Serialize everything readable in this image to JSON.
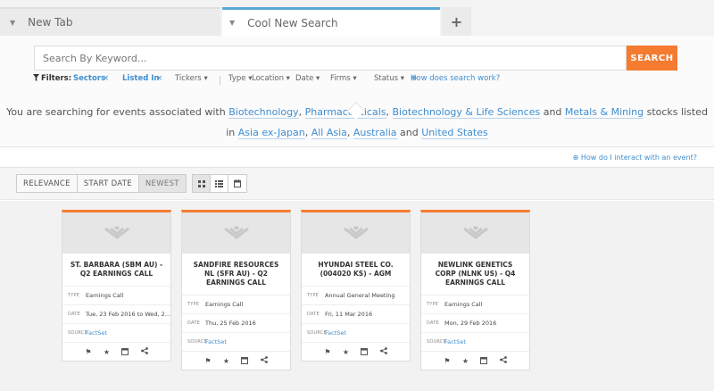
{
  "tabs": [
    {
      "label": "New Tab"
    },
    {
      "label": "Cool New Search"
    }
  ],
  "tab_add_label": "+",
  "search": {
    "placeholder": "Search By Keyword...",
    "button_label": "SEARCH"
  },
  "filters": {
    "label": "Filters:",
    "selected": [
      {
        "label": "Sectors",
        "remove": "×"
      },
      {
        "label": "Listed In",
        "remove": "×"
      }
    ],
    "dropdowns": [
      "Tickers",
      "Type",
      "Location",
      "Date",
      "Firms",
      "Status"
    ],
    "help_link": "How does search work?"
  },
  "description": {
    "prefix": "You are searching for events associated with",
    "sectors": [
      "Biotechnology",
      "Pharmaceuticals",
      "Biotechnology & Life Sciences",
      "Metals & Mining"
    ],
    "middle": "stocks listed",
    "in_word": "in",
    "locations": [
      "Asia ex-Japan",
      "All Asia",
      "Australia",
      "United States"
    ],
    "and_word": "and"
  },
  "interact_help": "How do I interact with an event?",
  "sort": {
    "options": [
      "RELEVANCE",
      "START DATE",
      "NEWEST"
    ],
    "active": "NEWEST"
  },
  "view_icons": [
    "grid-view-icon",
    "list-view-icon",
    "calendar-view-icon"
  ],
  "card_labels": {
    "type": "TYPE",
    "date": "DATE",
    "source": "SOURCE"
  },
  "cards": [
    {
      "title": "ST. BARBARA (SBM AU) - Q2 EARNINGS CALL",
      "type": "Earnings Call",
      "date": "Tue, 23 Feb 2016 to Wed, 2...",
      "source": "FactSet"
    },
    {
      "title": "SANDFIRE RESOURCES NL (SFR AU) - Q2 EARNINGS CALL",
      "type": "Earnings Call",
      "date": "Thu, 25 Feb 2016",
      "source": "FactSet"
    },
    {
      "title": "HYUNDAI STEEL CO. (004020 KS) - AGM",
      "type": "Annual General Meeting",
      "date": "Fri, 11 Mar 2016",
      "source": "FactSet"
    },
    {
      "title": "NEWLINK GENETICS CORP (NLNK US) - Q4 EARNINGS CALL",
      "type": "Earnings Call",
      "date": "Mon, 29 Feb 2016",
      "source": "FactSet"
    }
  ],
  "colors": {
    "accent": "#f47b30",
    "link": "#3f8ed0",
    "tab_active": "#5aabd6"
  }
}
